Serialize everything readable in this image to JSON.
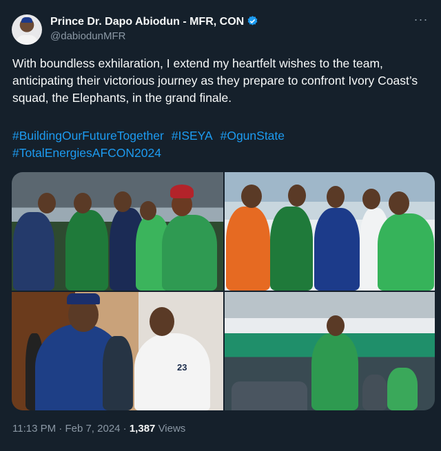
{
  "author": {
    "name": "Prince Dr. Dapo Abiodun - MFR, CON",
    "handle": "@dabiodunMFR",
    "avatar_icon": "avatar-photo",
    "verified_icon": "verified-badge-icon",
    "verified_color": "#1d9bf0"
  },
  "more_icon": "more-options-icon",
  "tweet": {
    "text": "With boundless exhilaration, I extend my heartfelt wishes to the team, anticipating their victorious journey as they prepare to confront Ivory Coast’s squad, the Elephants, in the grand finale.",
    "hashtags": [
      "#BuildingOurFutureTogether",
      "#ISEYA",
      "#OgunState",
      "#TotalEnergiesAFCON2024"
    ],
    "hashtag_color": "#1d9bf0"
  },
  "media": {
    "photos": [
      "photo-group-suits",
      "photo-group-caps",
      "photo-handshake",
      "photo-stadium"
    ],
    "jersey_number": "23"
  },
  "meta": {
    "time": "11:13 PM",
    "separator": "·",
    "date": "Feb 7, 2024",
    "views_count": "1,387",
    "views_label": "Views"
  }
}
